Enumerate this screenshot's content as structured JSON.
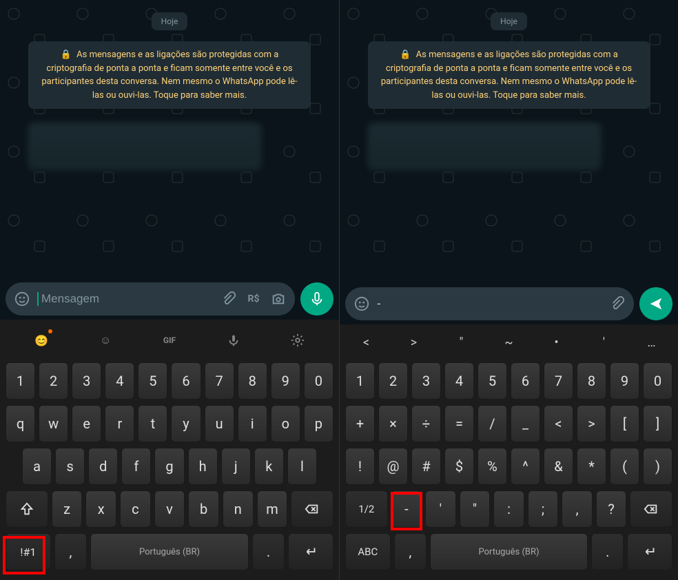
{
  "date_label": "Hoje",
  "encryption_notice": "As mensagens e as ligações são protegidas com a criptografia de ponta a ponta e ficam somente entre você e os participantes desta conversa. Nem mesmo o WhatsApp pode lê-las ou ouvi-las. Toque para saber mais.",
  "left": {
    "input_placeholder": "Mensagem",
    "input_value": "",
    "money_label": "R$",
    "kb_rows": {
      "num": [
        "1",
        "2",
        "3",
        "4",
        "5",
        "6",
        "7",
        "8",
        "9",
        "0"
      ],
      "r1": [
        "q",
        "w",
        "e",
        "r",
        "t",
        "y",
        "u",
        "i",
        "o",
        "p"
      ],
      "r2": [
        "a",
        "s",
        "d",
        "f",
        "g",
        "h",
        "j",
        "k",
        "l"
      ],
      "r3": [
        "z",
        "x",
        "c",
        "v",
        "b",
        "n",
        "m"
      ],
      "mode_key": "!#1",
      "space_label": "Português (BR)",
      "comma": ",",
      "period": "."
    }
  },
  "right": {
    "input_value": "-",
    "suggestions": [
      "<",
      ">",
      "\"",
      "~",
      "•",
      "'",
      "…"
    ],
    "kb_rows": {
      "num": [
        "1",
        "2",
        "3",
        "4",
        "5",
        "6",
        "7",
        "8",
        "9",
        "0"
      ],
      "r1": [
        "+",
        "×",
        "÷",
        "=",
        "/",
        "_",
        "<",
        ">",
        "[",
        "]"
      ],
      "r2": [
        "!",
        "@",
        "#",
        "$",
        "%",
        "^",
        "&",
        "*",
        "(",
        ")"
      ],
      "r3_first": "1/2",
      "r3": [
        "-",
        "'",
        "\"",
        ":",
        ";",
        ",",
        "?"
      ],
      "mode_key": "ABC",
      "space_label": "Português (BR)",
      "comma": ",",
      "period": "."
    }
  }
}
